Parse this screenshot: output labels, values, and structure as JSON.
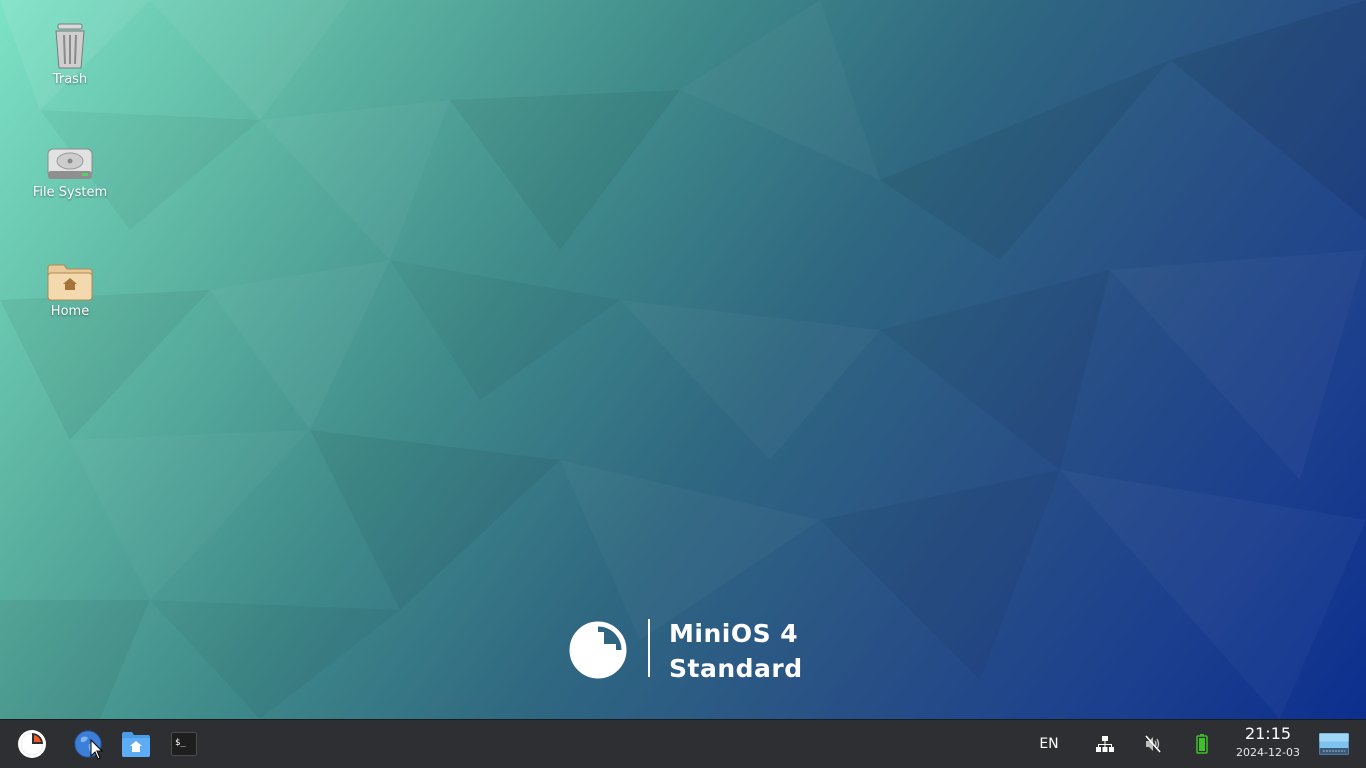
{
  "desktop": {
    "icons": [
      {
        "label": "Trash"
      },
      {
        "label": "File System"
      },
      {
        "label": "Home"
      }
    ],
    "branding": {
      "line1": "MiniOS 4",
      "line2": "Standard"
    }
  },
  "taskbar": {
    "launchers": [
      {
        "icon": "minios-menu-icon"
      },
      {
        "icon": "web-browser-icon"
      },
      {
        "icon": "file-manager-icon"
      },
      {
        "icon": "terminal-icon"
      }
    ],
    "tray": {
      "keyboard_layout": "EN",
      "network_icon": "network-wired-icon",
      "volume_icon": "volume-muted-icon",
      "battery_icon": "battery-icon"
    },
    "clock": {
      "time": "21:15",
      "date": "2024-12-03"
    },
    "show_desktop_icon": "show-desktop-icon"
  },
  "colors": {
    "taskbar_bg": "#2d2f32",
    "accent_orange": "#f05a22",
    "battery_green": "#3fbf2a"
  }
}
